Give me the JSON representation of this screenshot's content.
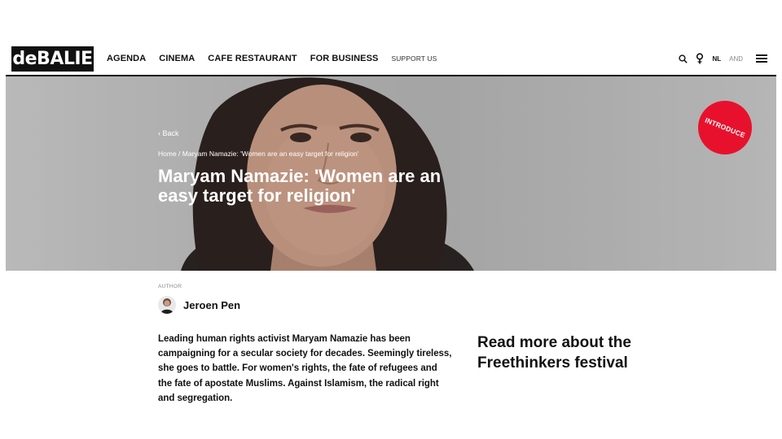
{
  "nav": {
    "logo": "deBALIE",
    "links": [
      "AGENDA",
      "CINEMA",
      "CAFE RESTAURANT",
      "FOR BUSINESS"
    ],
    "support": "SUPPORT US",
    "lang_active": "NL",
    "lang_inactive": "AND",
    "icons": [
      "search-icon",
      "location-pin-icon",
      "menu-icon"
    ]
  },
  "hero": {
    "back": "‹ Back",
    "breadcrumb_home": "Home",
    "breadcrumb_sep": " / ",
    "breadcrumb_current": "Maryam Namazie: 'Women are an easy target for religion'",
    "title": "Maryam Namazie: 'Women are an easy target for religion'",
    "badge": "INTRODUCE"
  },
  "author": {
    "label": "AUTHOR",
    "name": "Jeroen Pen"
  },
  "article": {
    "intro": "Leading human rights activist Maryam Namazie has been campaigning for a secular society for decades. Seemingly tireless, she goes to battle. For women's rights, the fate of refugees and the fate of apostate Muslims. Against Islamism, the radical right and segregation."
  },
  "aside": {
    "link": "Read more about the Freethinkers festival"
  },
  "colors": {
    "brand_black": "#111111",
    "badge_red": "#e8112d"
  }
}
